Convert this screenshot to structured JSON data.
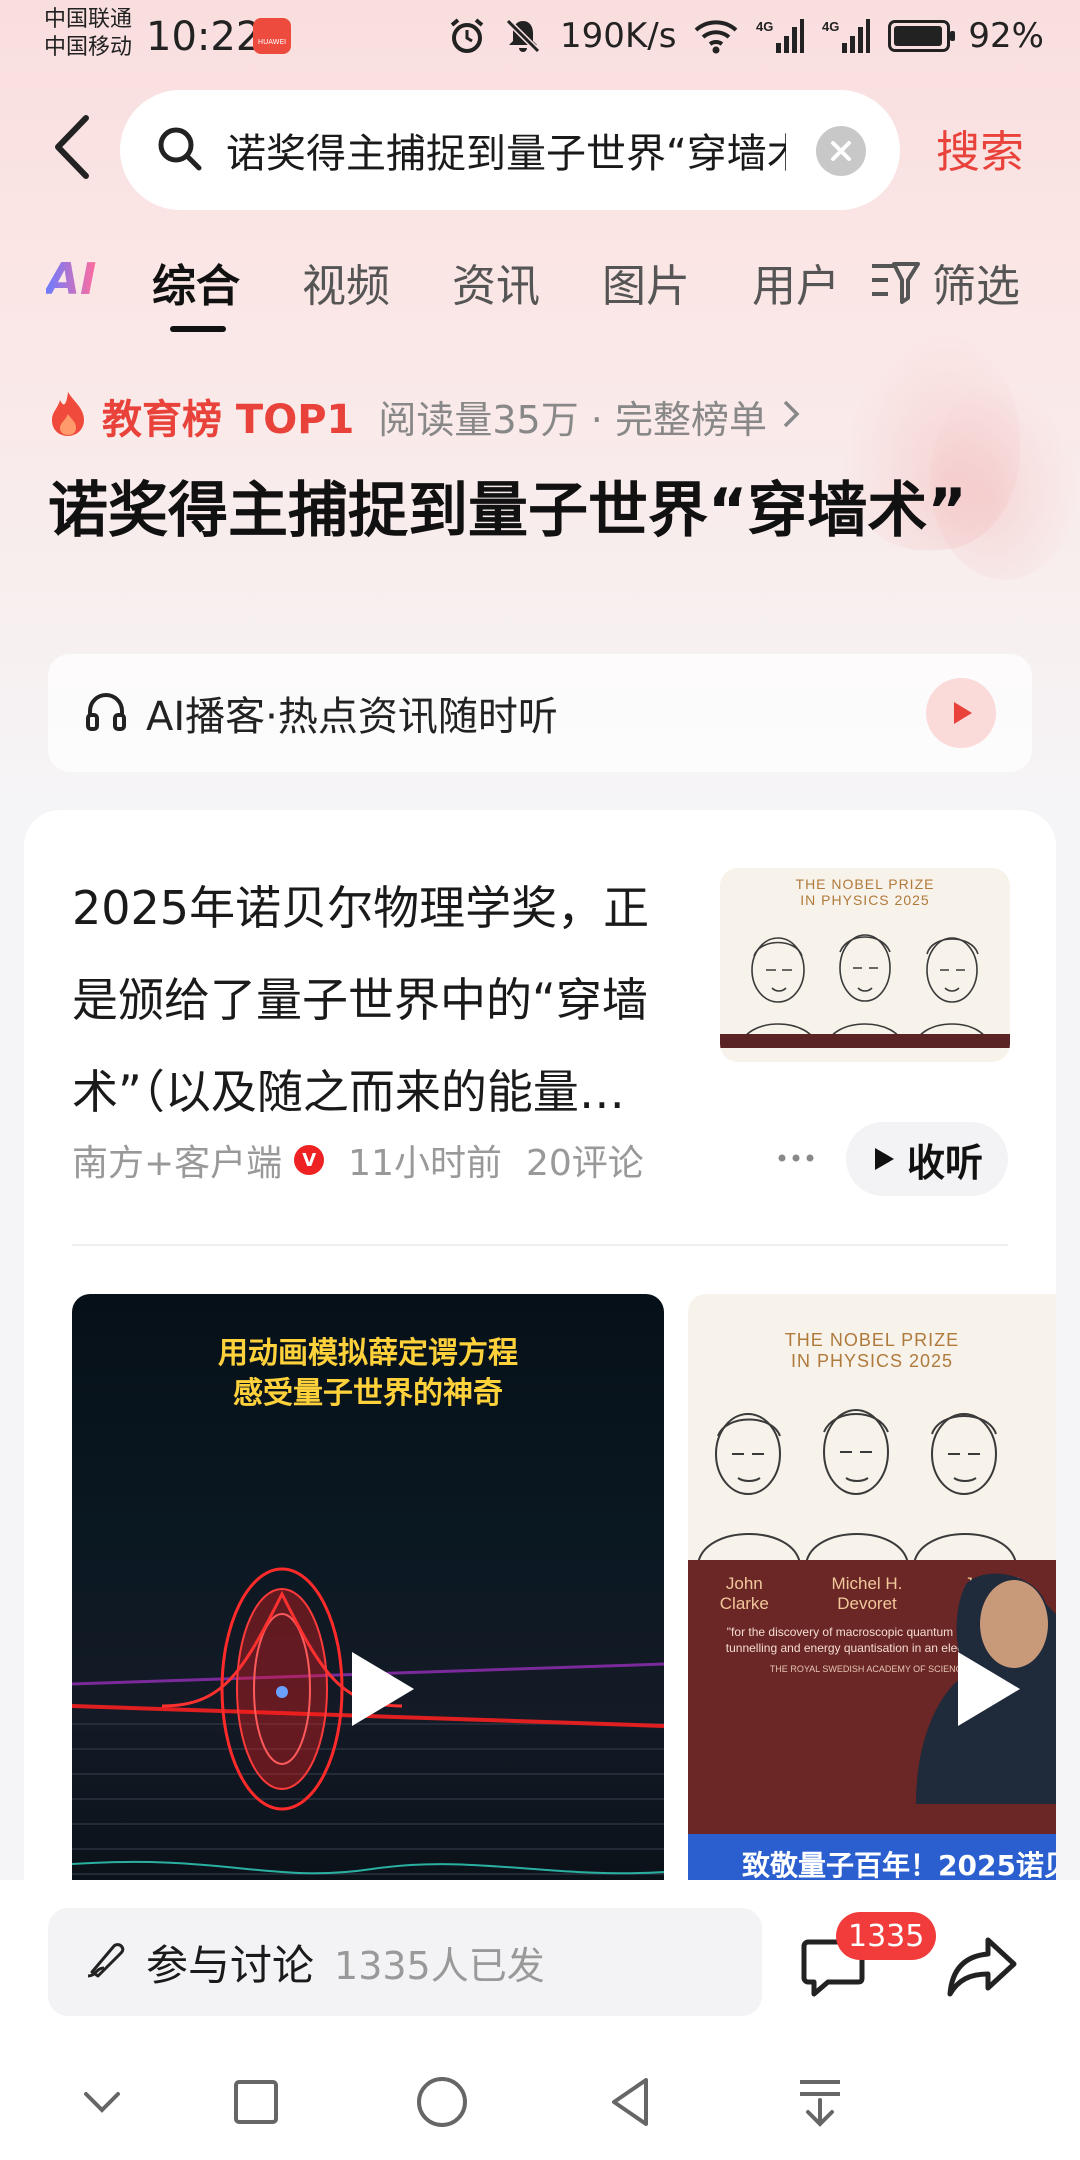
{
  "status_bar": {
    "carrier_1": "中国联通",
    "carrier_2": "中国移动",
    "time": "10:22",
    "app_icon_label": "HUAWEI",
    "network_speed": "190K/s",
    "signal_1": "4G",
    "signal_2": "4G",
    "battery": "92%"
  },
  "search": {
    "query": "诺奖得主捕捉到量子世界“穿墙术”",
    "button_label": "搜索"
  },
  "tabs": {
    "ai": "AI",
    "items": [
      "综合",
      "视频",
      "资讯",
      "图片",
      "用户"
    ],
    "filter": "筛选",
    "active": "综合"
  },
  "hot_rank": {
    "label": "教育榜 TOP1",
    "meta": "阅读量35万 · 完整榜单",
    "headline": "诺奖得主捕捉到量子世界“穿墙术”"
  },
  "podcast": {
    "label": "AI播客·热点资讯随时听"
  },
  "article": {
    "summary": "2025年诺贝尔物理学奖，正是颁给了量子世界中的“穿墙术”（以及随之而来的能量…",
    "source": "南方+客户端",
    "verified_badge": "V",
    "time": "11小时前",
    "comments": "20评论",
    "listen_label": "收听",
    "thumb_title_1": "THE NOBEL PRIZE",
    "thumb_title_2": "IN PHYSICS 2025"
  },
  "videos": [
    {
      "caption_1": "用动画模拟薛定谔方程",
      "caption_2": "感受量子世界的神奇"
    },
    {
      "title_1": "THE NOBEL PRIZE",
      "title_2": "IN PHYSICS 2025",
      "names": [
        "John Clarke",
        "Michel H. Devoret",
        "John M. Martinis"
      ],
      "citation": "\"for the discovery of macroscopic quantum mechanical tunnelling and energy quantisation in an electric circuit\"",
      "academy": "THE ROYAL SWEDISH ACADEMY OF SCIENCES",
      "banner": "致敬量子百年！2025诺贝"
    }
  ],
  "bottom_bar": {
    "comment_label": "参与讨论",
    "comment_count": "1335人已发",
    "badge_count": "1335"
  },
  "colors": {
    "accent": "#e8423a",
    "badge": "#f23c3c"
  }
}
